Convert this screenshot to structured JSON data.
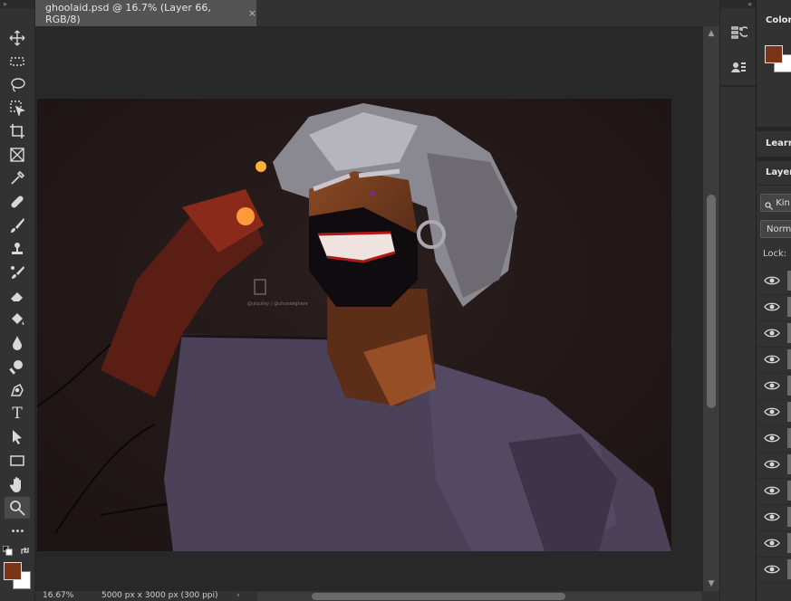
{
  "document": {
    "tab_title": "ghoolaid.psd @ 16.7% (Layer 66, RGB/8)",
    "close_glyph": "×"
  },
  "status": {
    "zoom": "16.67%",
    "doc_info": "5000 px x 3000 px (300 ppi)",
    "arrow": "›"
  },
  "toolbar": {
    "grip": "»",
    "tools": [
      "move-tool",
      "marquee-tool",
      "lasso-tool",
      "object-select-tool",
      "crop-tool",
      "frame-tool",
      "eyedropper-tool",
      "healing-brush-tool",
      "brush-tool",
      "clone-stamp-tool",
      "history-brush-tool",
      "eraser-tool",
      "paint-bucket-tool",
      "blur-tool",
      "dodge-tool",
      "pen-tool",
      "type-tool",
      "path-select-tool",
      "rectangle-tool",
      "hand-tool",
      "zoom-tool",
      "more-tools"
    ],
    "type_glyph": "T",
    "more_glyph": "•••",
    "foreground_color": "#7a3418",
    "background_color": "#ffffff"
  },
  "dock": {
    "grip": "«"
  },
  "panels": {
    "color_tab": "Color",
    "learn_tab": "Learn",
    "layers_tab": "Layers",
    "kind_filter": "Kin",
    "blend_mode": "Norma",
    "lock_label": "Lock:",
    "layer_count_visible": 12
  },
  "artwork": {
    "watermark": "@ulquilsy / @uhoolaighere"
  }
}
